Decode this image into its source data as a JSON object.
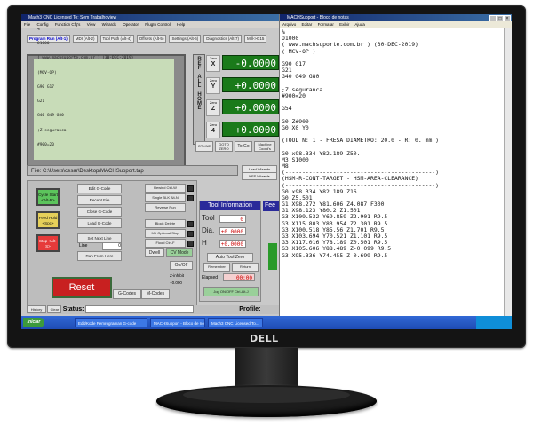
{
  "mach3": {
    "title": "Mach3 CNC Licensed To: Sem Trabalhoview",
    "menu": [
      "File",
      "Config",
      "Function Cfg's",
      "View",
      "Wizards",
      "Operator",
      "PlugIn Control",
      "Help"
    ],
    "tabs": [
      {
        "label": "Program Run (Alt-1)",
        "active": true
      },
      {
        "label": "MDI (Alt-2)",
        "active": false
      },
      {
        "label": "Tool Path (Alt-4)",
        "active": false
      },
      {
        "label": "Offsets (Alt-5)",
        "active": false
      },
      {
        "label": "Settings (Alt-6)",
        "active": false
      },
      {
        "label": "Diagnostics (Alt-7)",
        "active": false
      },
      {
        "label": "Mill->G15",
        "active": false
      }
    ],
    "gcode_lines": [
      "%",
      "O1000",
      "( www.machsuporte.com.br ) (30-DEC-2019)",
      "(MCV-OP)",
      "G90 G17",
      "G21",
      "G40 G49 G80",
      ";Z seguranca",
      "#900=20"
    ],
    "ref_all_home": "REF ALL HOME",
    "axes": [
      {
        "zero": "Zero",
        "axis": "X",
        "value": "-0.0000"
      },
      {
        "zero": "Zero",
        "axis": "Y",
        "value": "+0.0000"
      },
      {
        "zero": "Zero",
        "axis": "Z",
        "value": "+0.0000"
      },
      {
        "zero": "Zero",
        "axis": "4",
        "value": "+0.0000"
      }
    ],
    "dro_buttons": {
      "otline": "OTLINE",
      "goto_zero": "GOTO ZERO",
      "to_go": "To Go",
      "machine_coords": "Machine Coord's"
    },
    "file_label": "File:",
    "file_path": "C:\\Users\\cesar\\Desktop\\MACHSupport.tap",
    "load_wizards": "Load Wizards",
    "nfs_wizards": "NFS Wizards",
    "cycle_start": "Cycle Start <Alt-R>",
    "feed_hold": "Feed Hold <Spc>",
    "stop": "Stop <Alt-S>",
    "mid_buttons": [
      "Edit G-Code",
      "Recent File",
      "Close G-Code",
      "Load G-Code",
      "Set Next Line",
      "Run From Here"
    ],
    "line_label": "Line",
    "line_value": "0",
    "right_buttons": [
      "Rewind Ctrl-W",
      "Single BLK Alt-N",
      "Reverse Run",
      "Block Delete",
      "M1 Optional Stop",
      "Flood Ctrl-F"
    ],
    "dwell": "Dwell",
    "cv_mode": "CV Mode",
    "on_off": "On/Off",
    "reset": "Reset",
    "gcodes": "G-Codes",
    "mcodes": "M-Codes",
    "z_inhibit": "Z-inhibit",
    "z_inhibit_value": "+0.000",
    "tool_info": {
      "title": "Tool Information",
      "tool_label": "Tool",
      "tool_value": "0",
      "dia_label": "Dia.",
      "dia_value": "+0.0000",
      "h_label": "H",
      "h_value": "+0.0000",
      "auto_tool_zero": "Auto Tool Zero",
      "remember": "Remember",
      "return": "Return",
      "elapsed_label": "Elapsed",
      "elapsed_value": "00:00",
      "jog": "Jog ON/OFF Ctrl-Alt-J"
    },
    "feed_label": "Fee",
    "status": {
      "history": "History",
      "clear": "Clear",
      "status_label": "Status:",
      "profile_label": "Profile:"
    }
  },
  "notepad": {
    "title": "MACHSupport - Bloco de notas",
    "menu": [
      "Arquivo",
      "Editar",
      "Formatar",
      "Exibir",
      "Ajuda"
    ],
    "lines": [
      "%",
      "O1000",
      "( www.machsuporte.com.br ) (30-DEC-2019)",
      "( MCV-OP )",
      "",
      "G90 G17",
      "G21",
      "G40 G49 G80",
      "",
      ";Z seguranca",
      "#900=20",
      "",
      "G54",
      "",
      "G0 Z#900",
      "G0 X0 Y0",
      "",
      "(TOOL N: 1 - FRESA DIAMETRO: 20.0 - R: 0. mm )",
      "",
      "G0 x98.334 Y82.189 Z50.",
      "M3 S1000",
      "M8",
      "(--------------------------------------------)",
      "(HSM-R-CONT-TARGET - HSM-AREA-CLEARANCE)",
      "(--------------------------------------------)",
      "G0 x98.334 Y82.189 Z16.",
      "G0 Z5.501",
      "G1 X98.272 Y81.606 Z4.087 F300",
      "G1 X98.123 Y80.2 Z1.501",
      "G3 X109.532 Y69.859 Z2.901 R9.5",
      "G3 X115.803 Y83.954 Z2.301 R9.5",
      "G3 X100.518 Y85.56 Z1.701 R9.5",
      "G3 X103.694 Y70.521 Z1.101 R9.5",
      "G3 X117.016 Y78.189 Z0.501 R9.5",
      "G3 X105.606 Y88.489 Z-0.099 R9.5",
      "G3 X95.336 Y74.455 Z-0.699 R9.5"
    ]
  },
  "taskbar": {
    "start": "Iniciar",
    "items": [
      "Edit/Kode Pemrograman G-code",
      "MACHSupport - Bloco de notas",
      "Mach3 CNC Licensed To..."
    ]
  },
  "brand": "DELL",
  "colors": {
    "dro_green": "#1a7a1a",
    "reset_red": "#c82020",
    "titlebar_blue": "#10246a",
    "taskbar_blue": "#3168d5"
  }
}
